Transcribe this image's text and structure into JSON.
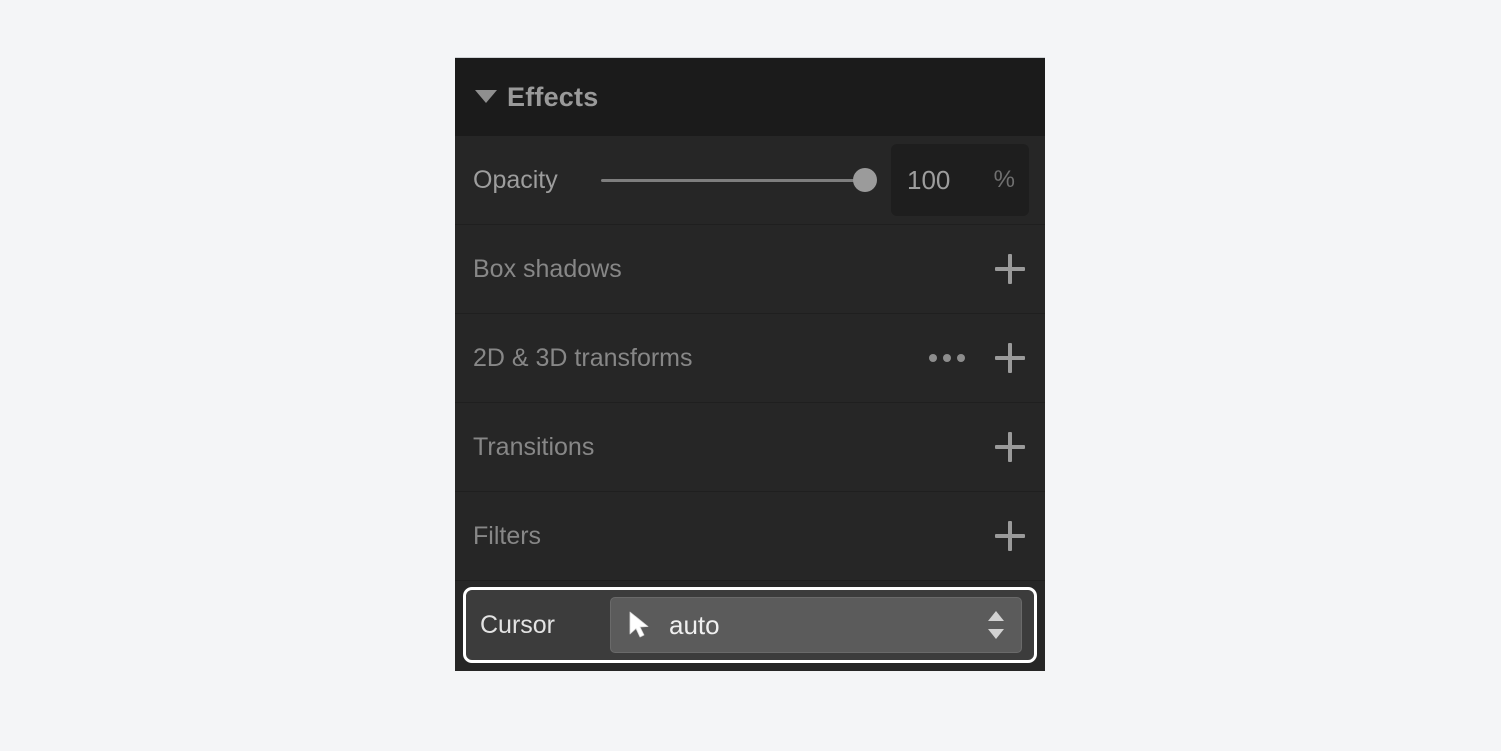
{
  "panel": {
    "header": {
      "title": "Effects",
      "disclosure_icon": "triangle-down-icon"
    },
    "opacity": {
      "label": "Opacity",
      "value": "100",
      "unit": "%",
      "slider_percent": 100
    },
    "rows": [
      {
        "label": "Box shadows",
        "has_ellipsis": false,
        "add_icon": "plus-icon"
      },
      {
        "label": "2D & 3D transforms",
        "has_ellipsis": true,
        "ellipsis_icon": "ellipsis-icon",
        "add_icon": "plus-icon"
      },
      {
        "label": "Transitions",
        "has_ellipsis": false,
        "add_icon": "plus-icon"
      },
      {
        "label": "Filters",
        "has_ellipsis": false,
        "add_icon": "plus-icon"
      }
    ],
    "cursor": {
      "label": "Cursor",
      "value": "auto",
      "pointer_icon": "arrow-pointer-icon",
      "stepper_icon": "chevron-up-down-icon",
      "focused": true
    }
  },
  "colors": {
    "page_background": "#f4f5f7",
    "panel_background": "#262626",
    "header_background": "#1b1b1b",
    "row_label": "#878787",
    "focus_ring": "#ffffff",
    "select_background": "#5b5b5b",
    "input_background": "#1e1e1e"
  }
}
